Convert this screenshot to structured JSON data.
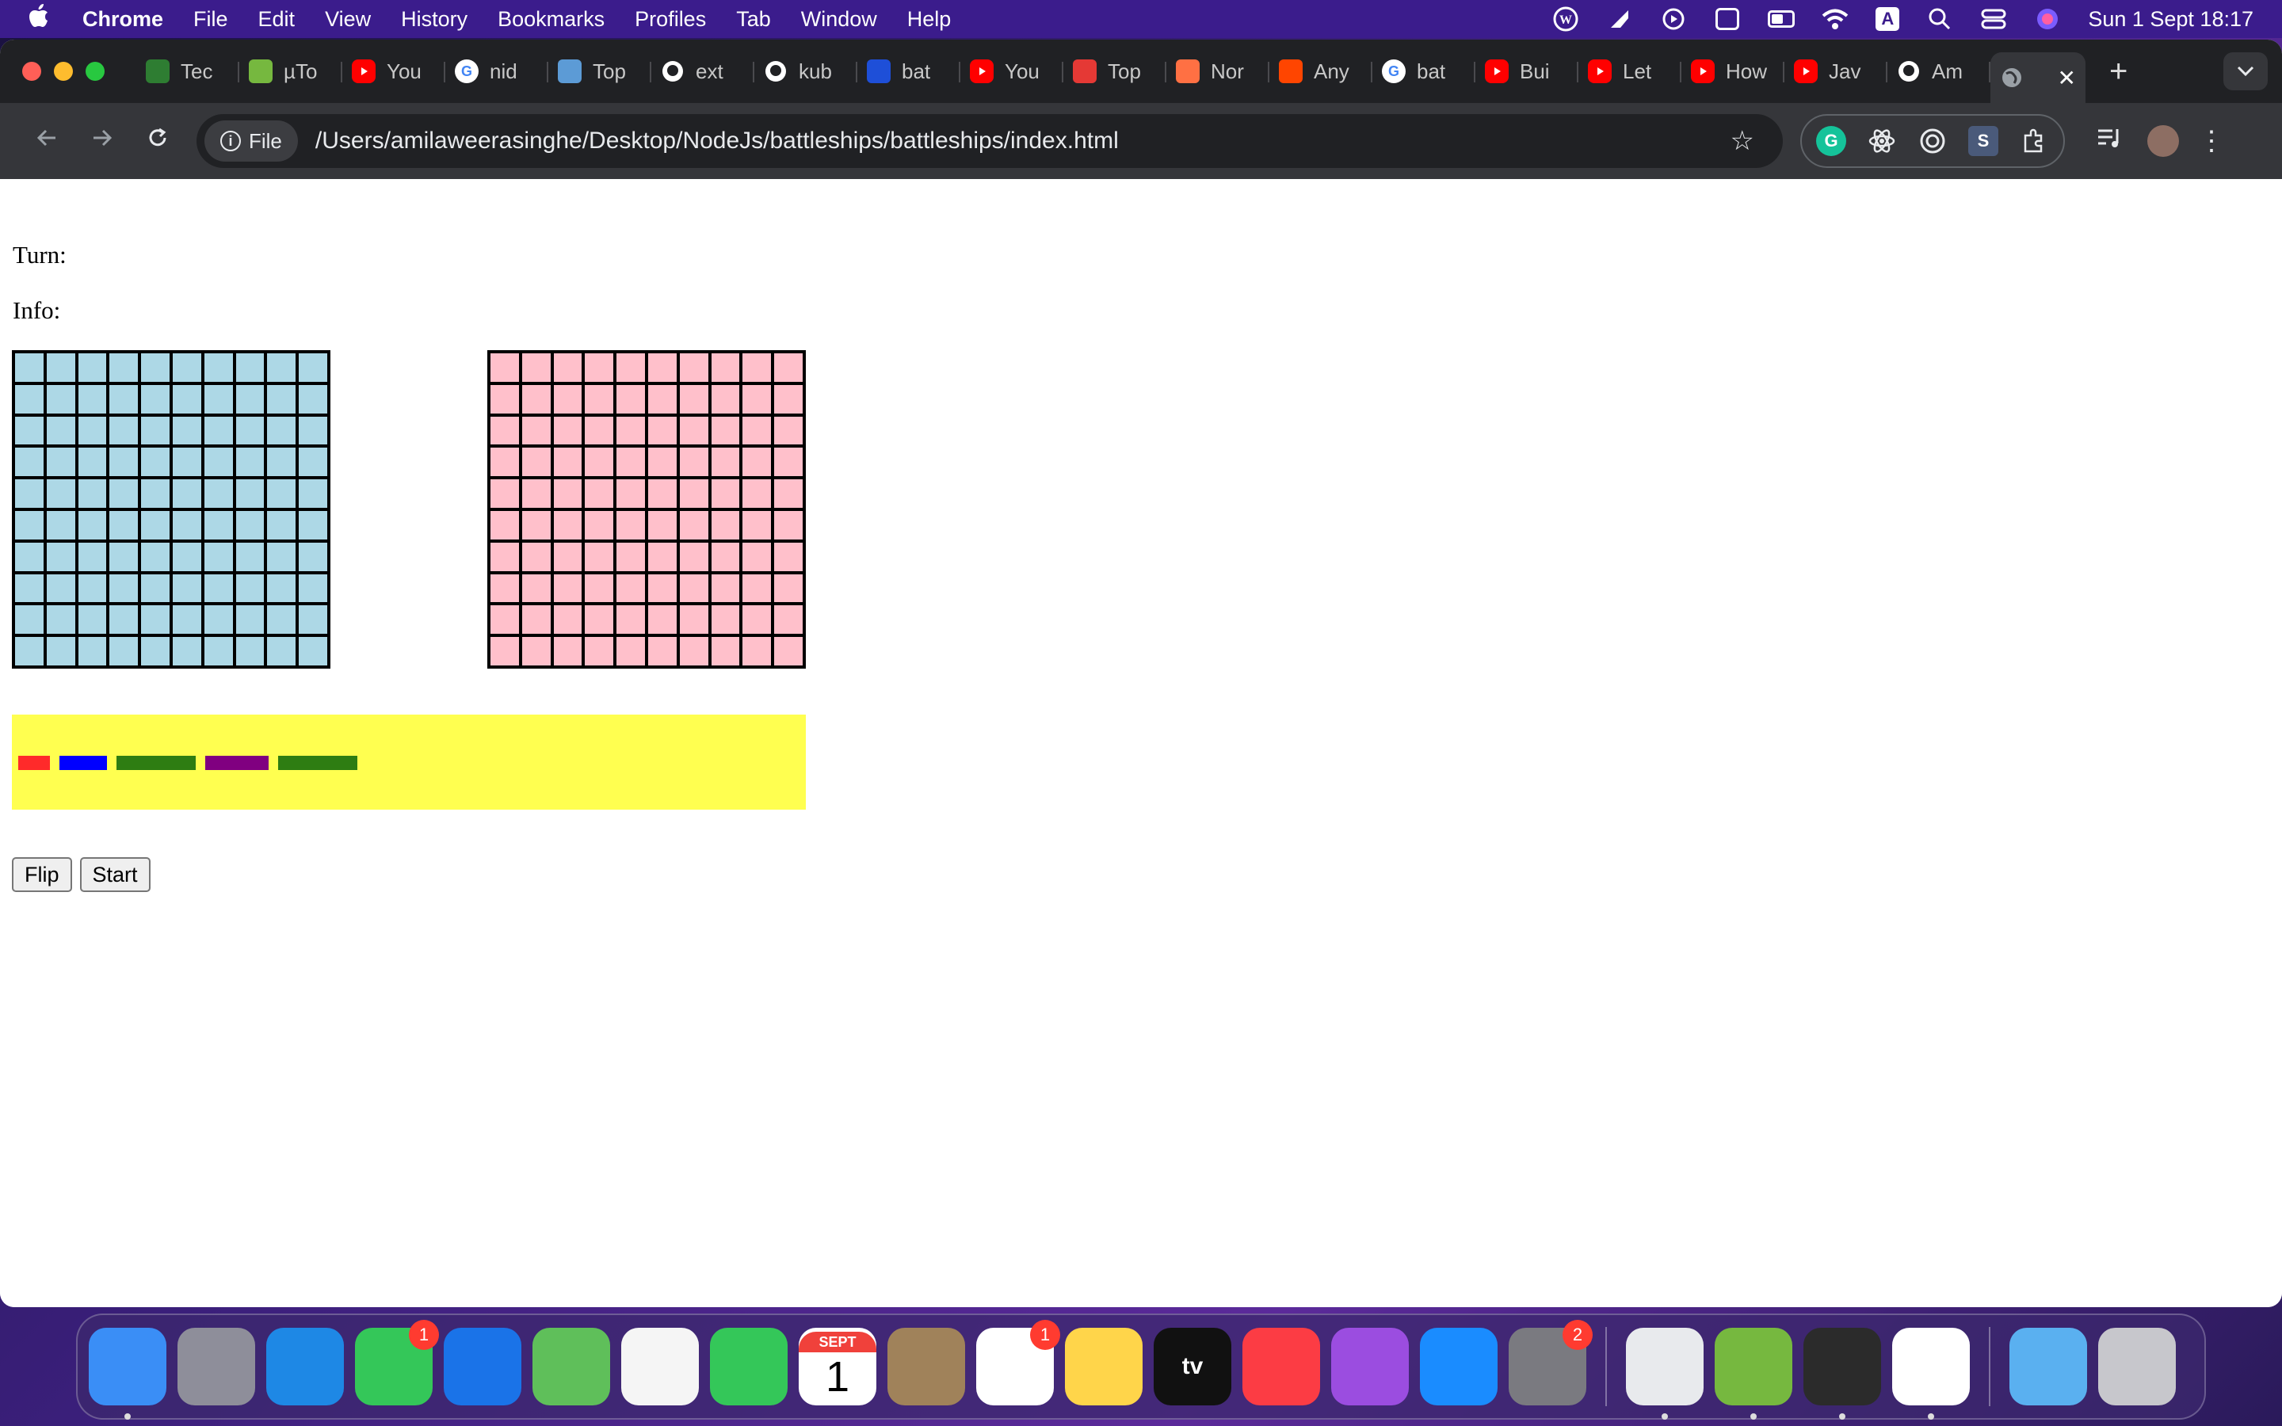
{
  "menubar": {
    "app_name": "Chrome",
    "items": [
      "File",
      "Edit",
      "View",
      "History",
      "Bookmarks",
      "Profiles",
      "Tab",
      "Window",
      "Help"
    ],
    "clock": "Sun 1 Sept  18:17",
    "kbd_label": "A"
  },
  "browser": {
    "tabs": [
      {
        "label": "Tec",
        "icon": "tech-icon",
        "color": "#2e7d32"
      },
      {
        "label": "µTo",
        "icon": "utorrent-icon",
        "color": "#76b83f"
      },
      {
        "label": "You",
        "icon": "youtube-icon",
        "color": "#ff0000"
      },
      {
        "label": "nid",
        "icon": "google-icon",
        "color": "#4285f4"
      },
      {
        "label": "Top",
        "icon": "mountain-icon",
        "color": "#5c9bd6"
      },
      {
        "label": "ext",
        "icon": "github-icon",
        "color": "#ffffff"
      },
      {
        "label": "kub",
        "icon": "github-icon",
        "color": "#ffffff"
      },
      {
        "label": "bat",
        "icon": "s-icon",
        "color": "#1e4fd8"
      },
      {
        "label": "You",
        "icon": "youtube-icon",
        "color": "#ff0000"
      },
      {
        "label": "Top",
        "icon": "layers-icon",
        "color": "#e53935"
      },
      {
        "label": "Nor",
        "icon": "slashes-icon",
        "color": "#ff7043"
      },
      {
        "label": "Any",
        "icon": "reddit-icon",
        "color": "#ff4500"
      },
      {
        "label": "bat",
        "icon": "google-icon",
        "color": "#4285f4"
      },
      {
        "label": "Bui",
        "icon": "youtube-icon",
        "color": "#ff0000"
      },
      {
        "label": "Let",
        "icon": "youtube-icon",
        "color": "#ff0000"
      },
      {
        "label": "How",
        "icon": "youtube-icon",
        "color": "#ff0000"
      },
      {
        "label": "Jav",
        "icon": "youtube-icon",
        "color": "#ff0000"
      },
      {
        "label": "Am",
        "icon": "github-icon",
        "color": "#ffffff"
      }
    ],
    "active_tab_close": "✕",
    "new_tab": "+",
    "chip_label": "File",
    "url": "/Users/amilaweerasinghe/Desktop/NodeJs/battleships/battleships/index.html"
  },
  "page": {
    "turn_label": "Turn:",
    "info_label": "Info:",
    "board_size": 10,
    "player_board_color": "#add8e6",
    "computer_board_color": "#ffc0cb",
    "ships": [
      {
        "name": "destroyer",
        "length": 2,
        "color": "#ff2a2a"
      },
      {
        "name": "submarine",
        "length": 3,
        "color": "#0000ff"
      },
      {
        "name": "cruiser",
        "length": 5,
        "color": "#2e7d12"
      },
      {
        "name": "battleship",
        "length": 4,
        "color": "#800080"
      },
      {
        "name": "carrier",
        "length": 5,
        "color": "#2e7d12"
      }
    ],
    "ship_container_color": "#ffff50",
    "flip_label": "Flip",
    "start_label": "Start"
  },
  "dock": {
    "apps": [
      {
        "name": "finder",
        "color": "#3a8ef6",
        "badge": ""
      },
      {
        "name": "launchpad",
        "color": "#8e8e9a",
        "badge": ""
      },
      {
        "name": "safari",
        "color": "#1e88e5",
        "badge": ""
      },
      {
        "name": "messages",
        "color": "#34c759",
        "badge": "1"
      },
      {
        "name": "mail",
        "color": "#1a73e8",
        "badge": ""
      },
      {
        "name": "maps",
        "color": "#5fbf5a",
        "badge": ""
      },
      {
        "name": "photos",
        "color": "#f5f5f5",
        "badge": ""
      },
      {
        "name": "facetime",
        "color": "#34c759",
        "badge": ""
      },
      {
        "name": "calendar",
        "color": "#ffffff",
        "badge": "",
        "month": "SEPT",
        "day": "1"
      },
      {
        "name": "contacts",
        "color": "#a0825a",
        "badge": ""
      },
      {
        "name": "reminders",
        "color": "#ffffff",
        "badge": "1"
      },
      {
        "name": "notes",
        "color": "#ffd54a",
        "badge": ""
      },
      {
        "name": "tv",
        "color": "#111111",
        "badge": "",
        "label": "tv"
      },
      {
        "name": "music",
        "color": "#fc3c44",
        "badge": ""
      },
      {
        "name": "podcasts",
        "color": "#9b4de0",
        "badge": ""
      },
      {
        "name": "app-store",
        "color": "#1a8cff",
        "badge": ""
      },
      {
        "name": "system-settings",
        "color": "#7a7a80",
        "badge": "2"
      }
    ],
    "running_apps": [
      {
        "name": "chrome",
        "color": "#e8eaed"
      },
      {
        "name": "utorrent",
        "color": "#76b83f"
      },
      {
        "name": "quicktime",
        "color": "#2b2b2b"
      },
      {
        "name": "vscode",
        "color": "#ffffff"
      }
    ],
    "extra": [
      {
        "name": "downloads-folder",
        "color": "#5ab0f0"
      },
      {
        "name": "trash",
        "color": "#c7c7cc"
      }
    ]
  }
}
